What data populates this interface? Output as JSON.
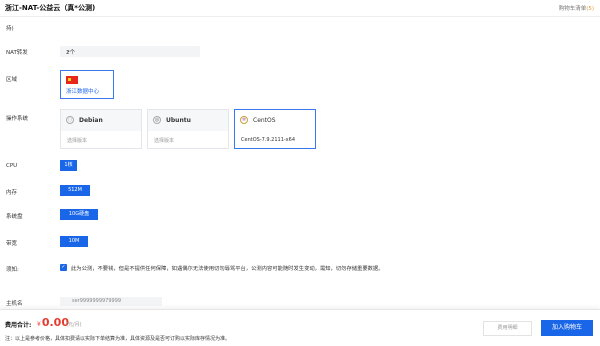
{
  "header": {
    "title": "浙江-NAT-公益云（真*公测)",
    "cart_link_prefix": "购物车清单",
    "cart_link_count": "(5)"
  },
  "partial_label": "持)",
  "nat": {
    "label": "NAT转发",
    "value": "2个"
  },
  "region": {
    "label": "区域",
    "name": "浙江数据中心"
  },
  "os": {
    "label": "操作系统",
    "options": [
      {
        "name": "Debian",
        "version": "选择版本",
        "icon": "debian-icon"
      },
      {
        "name": "Ubuntu",
        "version": "选择版本",
        "icon": "ubuntu-icon"
      },
      {
        "name": "CentOS",
        "version": "CentOS-7.9.2111-x64",
        "icon": "centos-icon",
        "selected": true
      }
    ]
  },
  "cpu": {
    "label": "CPU",
    "value": "1核"
  },
  "memory": {
    "label": "内存",
    "value": "512M"
  },
  "disk": {
    "label": "系统盘",
    "value": "10G硬盘"
  },
  "bandwidth": {
    "label": "带宽",
    "value": "10M"
  },
  "terms": {
    "label": "须知:",
    "checked": true,
    "text": "此为公测，不要钱，但是不提供任何保障，如遇偶尔无法使用切勿辱骂平台，公测内容可能随时发生变动，需知，切勿存储重要数据。"
  },
  "hostname": {
    "label": "主机名",
    "value": "ser9999999979999"
  },
  "footer": {
    "fee_label": "费用合计:",
    "currency": "¥",
    "amount": "0.00",
    "unit": "(元/月)",
    "note": "注：以上是参考价格，具体扣费请以实际下单结算为准，具体资源及是否可订购以实际库存情况为准。",
    "detail_button": "费用明细",
    "cart_button": "加入购物车"
  },
  "colors": {
    "primary": "#1a66e8",
    "price": "#e53a2d",
    "accent": "#e69d2e"
  }
}
